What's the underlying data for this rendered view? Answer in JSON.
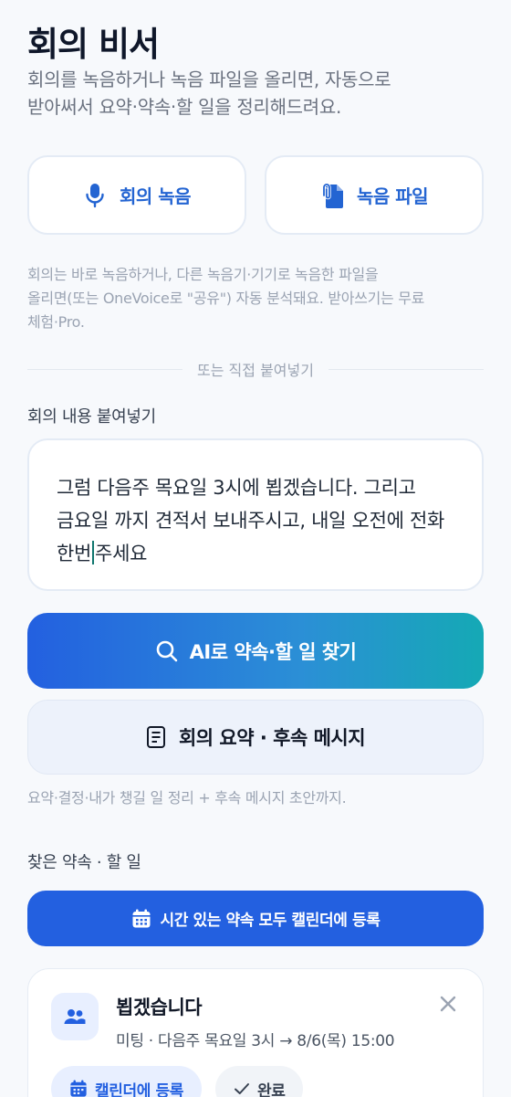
{
  "header": {
    "title": "회의 비서",
    "subtitle_line1": "회의를 녹음하거나 녹음 파일을 올리면, 자동으로",
    "subtitle_line2": "받아써서 요약·약속·할 일을 정리해드려요."
  },
  "source_buttons": {
    "record": {
      "label": "회의 녹음",
      "icon": "mic-icon"
    },
    "file": {
      "label": "녹음 파일",
      "icon": "attachment-file-icon"
    }
  },
  "hint": {
    "line1": "회의는 바로 녹음하거나, 다른 녹음기·기기로 녹음한 파일을",
    "line2": "올리면(또는 OneVoice로 \"공유\") 자동 분석돼요. 받아쓰기는 무료",
    "line3": "체험·Pro."
  },
  "divider_label": "또는 직접 붙여넣기",
  "paste": {
    "label": "회의 내용 붙여넣기",
    "line1": "그럼 다음주 목요일 3시에 뵙겠습니다. 그리고",
    "line2": "금요일 까지 견적서 보내주시고, 내일 오전에 전화",
    "line3_before_caret": "한번",
    "line3_after_caret": "주세요"
  },
  "actions": {
    "ai_find_label": "AI로 약속·할 일 찾기",
    "summary_label": "회의 요약 · 후속 메시지",
    "summary_hint": "요약·결정·내가 챙길 일 정리 + 후속 메시지 초안까지."
  },
  "results": {
    "section_label": "찾은 약속 · 할 일",
    "add_all_label": "시간 있는 약속 모두 캘린더에 등록",
    "items": [
      {
        "title": "뵙겠습니다",
        "meta": "미팅 · 다음주 목요일 3시 → 8/6(목) 15:00",
        "add_calendar_label": "캘린더에 등록",
        "done_label": "완료"
      }
    ]
  },
  "colors": {
    "accent": "#2360e0",
    "accent_text": "#2364d2",
    "gradient_end": "#15a9b5",
    "muted_text": "#9aa3b2",
    "background": "#f7f9fc"
  }
}
